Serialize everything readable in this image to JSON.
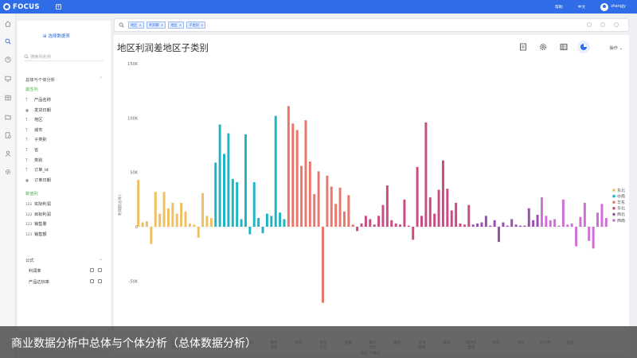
{
  "topbar": {
    "brand": "FOCUS",
    "help": "帮助",
    "language": "中文",
    "username": "zhangjy"
  },
  "left_panel": {
    "select_table_button": "选择数据表",
    "search_placeholder": "搜索列名称",
    "section_title": "总体与个体分析",
    "attributes_label": "属性列",
    "attribute_fields": [
      {
        "type": "T",
        "label": "产品名称"
      },
      {
        "type": "cal",
        "label": "发货日期"
      },
      {
        "type": "T",
        "label": "地区"
      },
      {
        "type": "T",
        "label": "城市"
      },
      {
        "type": "T",
        "label": "子类别"
      },
      {
        "type": "T",
        "label": "省"
      },
      {
        "type": "T",
        "label": "类别"
      },
      {
        "type": "T",
        "label": "订单_id"
      },
      {
        "type": "cal",
        "label": "订单日期"
      }
    ],
    "measures_label": "数值列",
    "measure_fields": [
      {
        "type": "123",
        "label": "实际利润"
      },
      {
        "type": "123",
        "label": "目标利润"
      },
      {
        "type": "123",
        "label": "销售量"
      },
      {
        "type": "123",
        "label": "销售额"
      }
    ],
    "formula_title": "公式",
    "formulas": [
      "利润率",
      "产品达标率"
    ]
  },
  "query": {
    "tokens": [
      "地区",
      "利润额",
      "地区",
      "子类别"
    ]
  },
  "chart_header": {
    "title": "地区利润差地区子类别",
    "operations_label": "操作"
  },
  "chart_data": {
    "type": "bar",
    "title": "地区利润差地区子类别",
    "ylabel": "利润额(总和)",
    "xlabel": "地区 子类别",
    "ylim": [
      -100000,
      150000
    ],
    "yticks": [
      "150K",
      "100K",
      "50K",
      "0",
      "-50K",
      "-100K"
    ],
    "ytick_values": [
      150000,
      100000,
      50000,
      0,
      -50000,
      -100000
    ],
    "legend": [
      {
        "name": "东北",
        "color": "#f0bf60"
      },
      {
        "name": "中南",
        "color": "#1fb5c4"
      },
      {
        "name": "华东",
        "color": "#e8786e"
      },
      {
        "name": "华北",
        "color": "#c94c83"
      },
      {
        "name": "西北",
        "color": "#9a4fb0"
      },
      {
        "name": "西南",
        "color": "#cf6fd8"
      }
    ],
    "legend_position": "right",
    "series": [
      {
        "region": "东北",
        "values": [
          43000,
          4000,
          5000,
          -16000,
          32000,
          12000,
          32000,
          17000,
          22000,
          12000,
          22000,
          14000,
          3000,
          2000,
          -10000,
          31000,
          10000,
          8000
        ]
      },
      {
        "region": "中南",
        "values": [
          59000,
          94000,
          67000,
          86000,
          44000,
          41000,
          7000,
          85000,
          -7000,
          41000,
          8000,
          -6000,
          12000,
          10000,
          102000,
          13000,
          7000
        ]
      },
      {
        "region": "华东",
        "values": [
          111000,
          95000,
          89000,
          56000,
          98000,
          60000,
          30000,
          51000,
          -70000,
          47000,
          37000,
          21000,
          36000,
          14000,
          29000,
          2000
        ]
      },
      {
        "region": "华北",
        "values": [
          -4000,
          3000,
          10000,
          7000,
          2000,
          10000,
          20000,
          38000,
          6000,
          3000,
          2000,
          25000,
          1000,
          -12000,
          55000,
          10000,
          96000,
          27000,
          12000,
          34000,
          61000,
          35000,
          15000,
          22000,
          3000,
          2000,
          20000
        ]
      },
      {
        "region": "西北",
        "values": [
          2000,
          3000,
          4000,
          10000,
          1000,
          6000,
          -14000,
          4000,
          1000,
          7000,
          2000,
          1000,
          1000,
          17000,
          6000,
          11000
        ]
      },
      {
        "region": "西南",
        "values": [
          27000,
          10000,
          6000,
          7000,
          1000,
          25000,
          2000,
          3000,
          -18000,
          9000,
          22000,
          -13000,
          -20000,
          13000,
          21000,
          8000
        ]
      }
    ],
    "x_tick_labels": [
      "东北",
      "中南",
      "华东",
      "印刷",
      "轴手",
      "书架",
      "电话",
      "设备",
      "椅子",
      "器具",
      "美术",
      "器具",
      "搅拌机",
      "纸张",
      "书架",
      "装订机",
      "设备"
    ],
    "x_tick_labels_line2": [
      "西北",
      "华东",
      "华东",
      "华北",
      "华北",
      "西南",
      "西南"
    ]
  },
  "caption": {
    "text": "商业数据分析中总体与个体分析（总体数据分析）"
  }
}
